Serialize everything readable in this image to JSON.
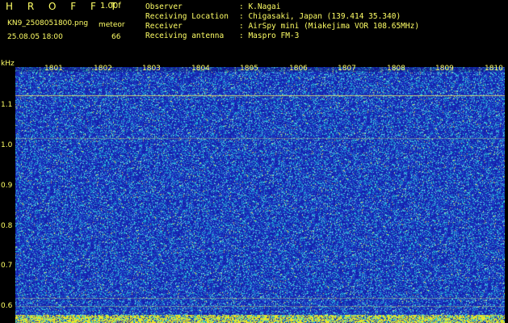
{
  "header": {
    "program_title": "H R O F F T",
    "version": "1.00f",
    "filename": "KN9_2508051800.png",
    "datetime": "25.08.05 18:00",
    "meteor_label": "meteor",
    "meteor_count": "66"
  },
  "info": [
    {
      "label": "Observer",
      "value": ": K.Nagai"
    },
    {
      "label": "Receiving Location",
      "value": ": Chigasaki, Japan (139.414 35.340)"
    },
    {
      "label": "Receiver",
      "value": ": AirSpy mini (Miakejima VOR 108.65MHz)"
    },
    {
      "label": "Receiving antenna",
      "value": ": Maspro FM-3"
    }
  ],
  "axis": {
    "y_unit": "kHz",
    "y_ticks": [
      "1.1",
      "1.0",
      "0.9",
      "0.8",
      "0.7",
      "0.6"
    ],
    "x_ticks": [
      "1801",
      "1802",
      "1803",
      "1804",
      "1805",
      "1806",
      "1807",
      "1808",
      "1809",
      "1810"
    ]
  },
  "colors": {
    "background": "#000000",
    "text": "#ffff66",
    "spectrogram_base": "#1a2fb8",
    "noise_cyan": "#22c8d8",
    "hline": "#e8e870"
  }
}
